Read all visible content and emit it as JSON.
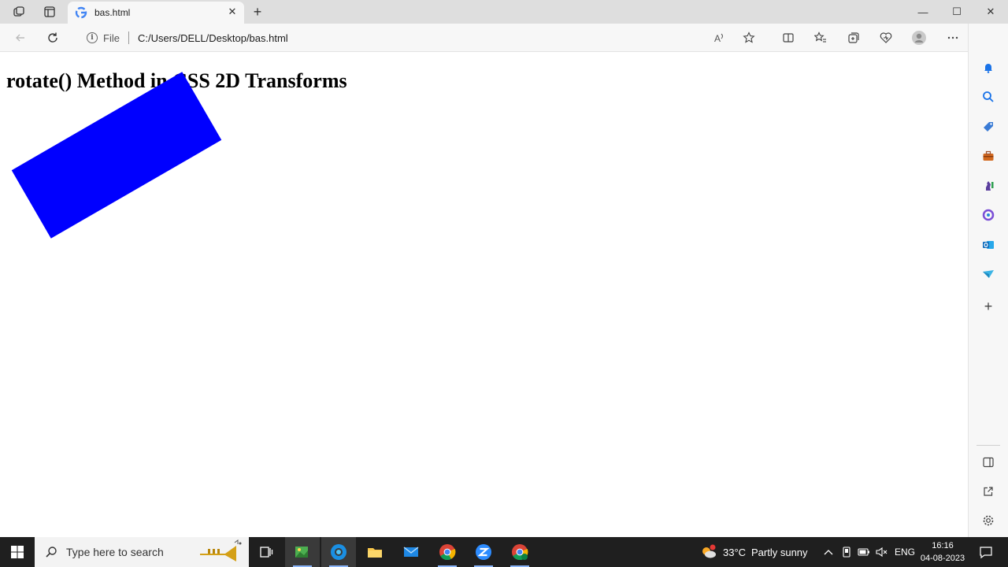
{
  "browser": {
    "tab": {
      "title": "bas.html"
    },
    "new_tab_label": "+",
    "address": {
      "scheme_label": "File",
      "url": "C:/Users/DELL/Desktop/bas.html"
    },
    "window_controls": {
      "minimize": "—",
      "maximize": "☐",
      "close": "✕"
    }
  },
  "page": {
    "heading": "rotate() Method in CSS 2D Transforms",
    "box_color": "#0000ff",
    "box_rotation_deg": -30
  },
  "sidebar": {
    "icons": [
      "bell-icon",
      "search-icon",
      "tag-icon",
      "toolbox-icon",
      "chess-icon",
      "office-icon",
      "outlook-icon",
      "send-icon",
      "add-icon",
      "sidebar-toggle-icon",
      "open-external-icon",
      "settings-icon"
    ]
  },
  "taskbar": {
    "search_placeholder": "Type here to search",
    "weather": {
      "temp": "33°C",
      "condition": "Partly sunny"
    },
    "language": "ENG",
    "time": "16:16",
    "date": "04-08-2023"
  },
  "colors": {
    "accent": "#0078d4",
    "box": "#0000ff",
    "taskbar": "#1f1f1f"
  }
}
